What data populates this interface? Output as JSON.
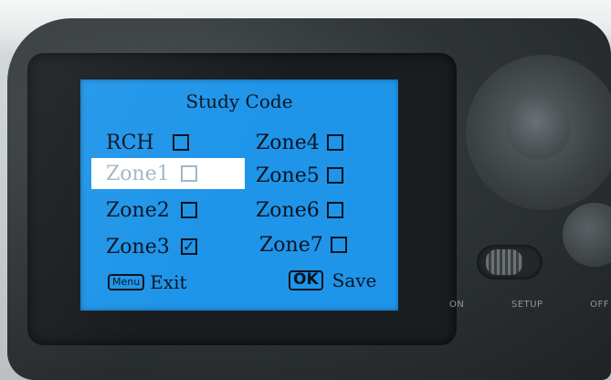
{
  "screen": {
    "title": "Study Code",
    "left_column": [
      {
        "label": "RCH",
        "checked": false,
        "selected": false
      },
      {
        "label": "Zone1",
        "checked": false,
        "selected": true
      },
      {
        "label": "Zone2",
        "checked": false,
        "selected": false
      },
      {
        "label": "Zone3",
        "checked": true,
        "selected": false
      }
    ],
    "right_column": [
      {
        "label": "Zone4",
        "checked": false
      },
      {
        "label": "Zone5",
        "checked": false
      },
      {
        "label": "Zone6",
        "checked": false
      },
      {
        "label": "Zone7",
        "checked": false
      }
    ],
    "footer": {
      "menu_key": "Menu",
      "menu_action": "Exit",
      "ok_key": "OK",
      "ok_action": "Save"
    }
  },
  "device": {
    "switch_labels": [
      "ON",
      "SETUP",
      "OFF"
    ]
  },
  "colors": {
    "screen_bg": "#1f95e9",
    "selected_bg": "#ffffff",
    "text": "#0b1420"
  },
  "icons": {
    "checkbox_checked": "checkmark-icon",
    "checkbox_empty": "empty-checkbox-icon"
  }
}
